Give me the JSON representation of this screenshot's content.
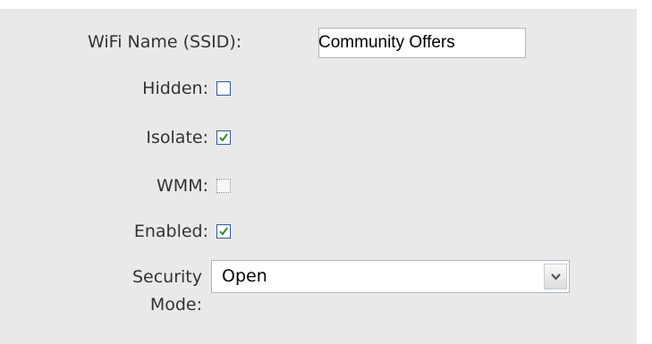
{
  "form": {
    "ssid_label": "WiFi Name (SSID):",
    "ssid_value": "Community Offers",
    "hidden_label": "Hidden:",
    "hidden_checked": false,
    "isolate_label": "Isolate:",
    "isolate_checked": true,
    "wmm_label": "WMM:",
    "wmm_checked": false,
    "wmm_disabled": true,
    "enabled_label": "Enabled:",
    "enabled_checked": true,
    "security_label_line1": "Security",
    "security_label_line2": "Mode:",
    "security_value": "Open"
  },
  "icons": {
    "check": "check-icon",
    "dropdown": "chevron-down-icon"
  },
  "colors": {
    "panel_bg": "#e9e9e9",
    "checkmark": "#2e8b2e",
    "checkbox_border": "#2e5a9a"
  }
}
